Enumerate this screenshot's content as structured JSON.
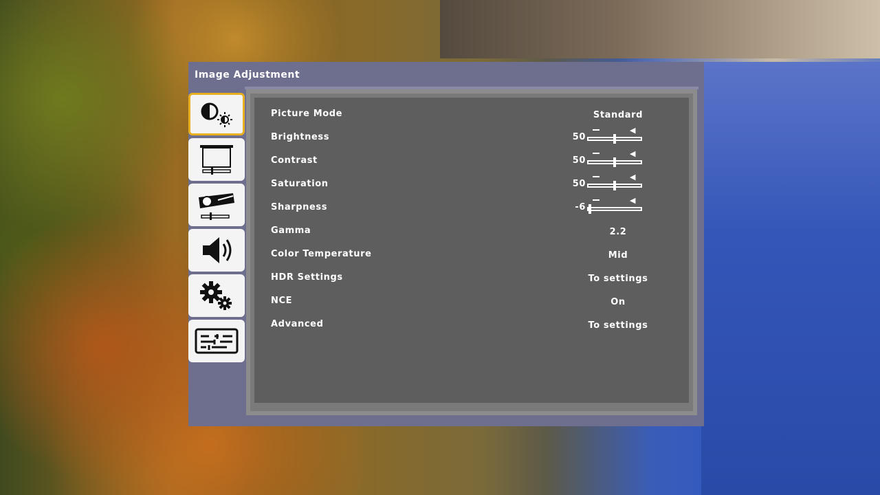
{
  "osd": {
    "title": "Image Adjustment",
    "sidebar": [
      {
        "icon": "picture-icon",
        "active": true
      },
      {
        "icon": "screen-icon",
        "active": false
      },
      {
        "icon": "projector-icon",
        "active": false
      },
      {
        "icon": "speaker-icon",
        "active": false
      },
      {
        "icon": "gears-icon",
        "active": false
      },
      {
        "icon": "info-panel-icon",
        "active": false
      }
    ],
    "rows": [
      {
        "label": "Picture Mode",
        "value": "Standard"
      },
      {
        "label": "Brightness",
        "value": "50",
        "slider": 0.5
      },
      {
        "label": "Contrast",
        "value": "50",
        "slider": 0.5
      },
      {
        "label": "Saturation",
        "value": "50",
        "slider": 0.5
      },
      {
        "label": "Sharpness",
        "value": "-6",
        "slider": 0.0
      },
      {
        "label": "Gamma",
        "value": "2.2"
      },
      {
        "label": "Color Temperature",
        "value": "Mid"
      },
      {
        "label": "HDR Settings",
        "value": "To settings"
      },
      {
        "label": "NCE",
        "value": "On"
      },
      {
        "label": "Advanced",
        "value": "To settings"
      }
    ]
  }
}
